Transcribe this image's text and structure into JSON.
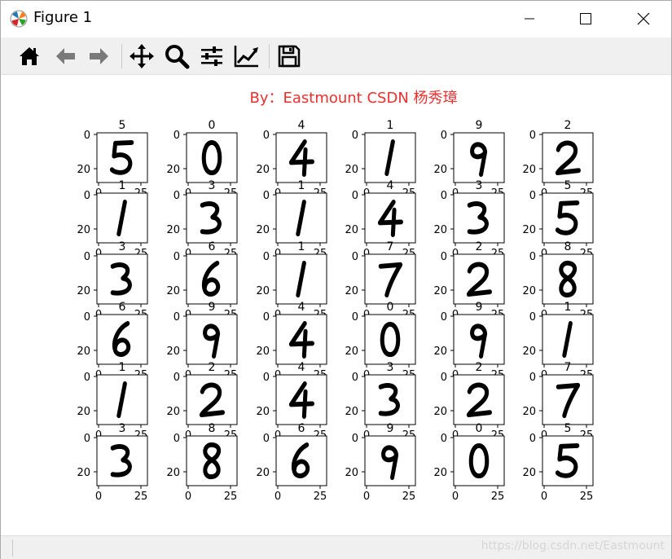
{
  "window": {
    "title": "Figure 1",
    "controls": {
      "minimize": "minimize",
      "maximize": "maximize",
      "close": "close"
    }
  },
  "toolbar": {
    "tools": [
      "home-icon",
      "back-arrow-icon",
      "forward-arrow-icon",
      "pan-move-icon",
      "zoom-magnifier-icon",
      "subplots-configure-icon",
      "edit-axis-line-icon",
      "save-floppy-icon"
    ]
  },
  "figure": {
    "suptitle": "By：Eastmount CSDN 杨秀璋",
    "suptitle_color": "#e8312f",
    "labels": [
      [
        "5",
        "0",
        "4",
        "1",
        "9",
        "2"
      ],
      [
        "1",
        "3",
        "1",
        "4",
        "3",
        "5"
      ],
      [
        "3",
        "6",
        "1",
        "7",
        "2",
        "8"
      ],
      [
        "6",
        "9",
        "4",
        "0",
        "9",
        "1"
      ],
      [
        "1",
        "2",
        "4",
        "3",
        "2",
        "7"
      ],
      [
        "3",
        "8",
        "6",
        "9",
        "0",
        "5"
      ]
    ],
    "y_tick_labels": [
      "0",
      "20"
    ],
    "x_tick_labels": [
      "0",
      "25"
    ]
  },
  "statusbar": {
    "watermark": "https://blog.csdn.net/Eastmount"
  }
}
